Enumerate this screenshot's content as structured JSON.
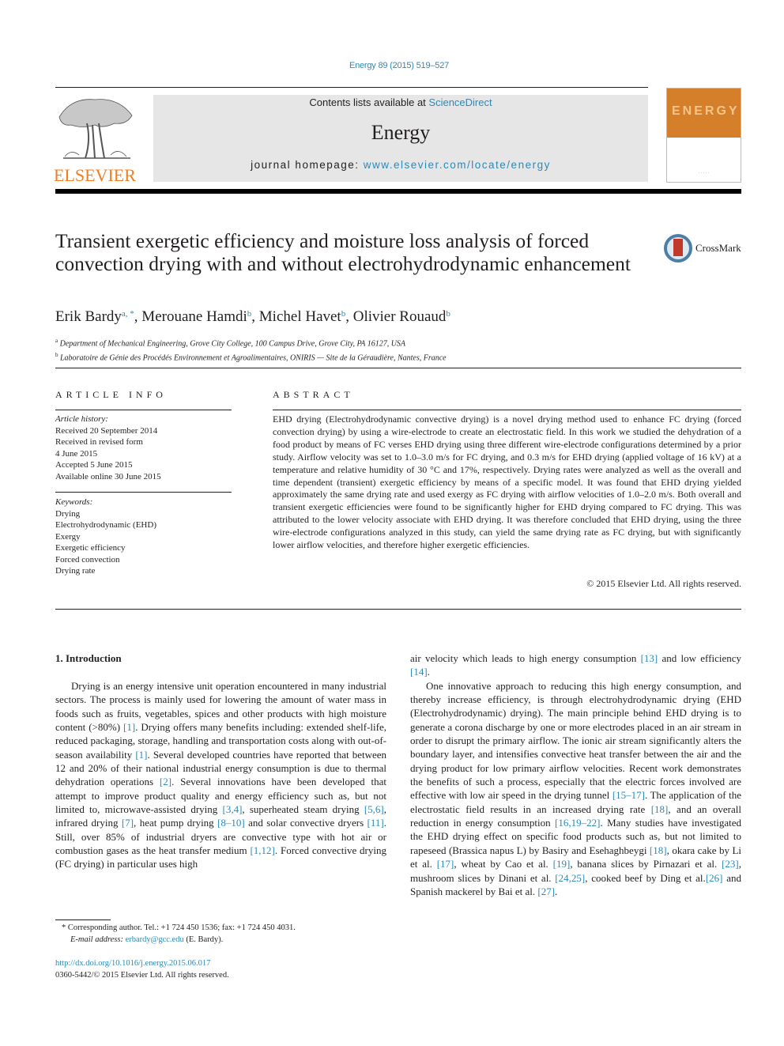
{
  "header": {
    "journal_ref": "Energy 89 (2015) 519–527",
    "publisher_logo_text": "ELSEVIER",
    "contents_prefix": "Contents lists available at ",
    "contents_link": "ScienceDirect",
    "journal_name": "Energy",
    "homepage_prefix": "journal homepage: ",
    "homepage_link": "www.elsevier.com/locate/energy",
    "cover_title": "ENERGY",
    "brand_color": "#f47c20",
    "link_color": "#2a8ab8"
  },
  "article": {
    "title": "Transient exergetic efficiency and moisture loss analysis of forced convection drying with and without electrohydrodynamic enhancement",
    "crossmark_label": "CrossMark",
    "authors": [
      {
        "name": "Erik Bardy",
        "sup": "a, *"
      },
      {
        "name": "Merouane Hamdi",
        "sup": "b"
      },
      {
        "name": "Michel Havet",
        "sup": "b"
      },
      {
        "name": "Olivier Rouaud",
        "sup": "b"
      }
    ],
    "affiliations": [
      {
        "sup": "a",
        "text": "Department of Mechanical Engineering, Grove City College, 100 Campus Drive, Grove City, PA 16127, USA"
      },
      {
        "sup": "b",
        "text": "Laboratoire de Génie des Procédés Environnement et Agroalimentaires, ONIRIS — Site de la Géraudière, Nantes, France"
      }
    ]
  },
  "article_info": {
    "heading": "ARTICLE INFO",
    "history_label": "Article history:",
    "history": [
      "Received 20 September 2014",
      "Received in revised form",
      "4 June 2015",
      "Accepted 5 June 2015",
      "Available online 30 June 2015"
    ],
    "keywords_label": "Keywords:",
    "keywords": [
      "Drying",
      "Electrohydrodynamic (EHD)",
      "Exergy",
      "Exergetic efficiency",
      "Forced convection",
      "Drying rate"
    ]
  },
  "abstract": {
    "heading": "ABSTRACT",
    "text": "EHD drying (Electrohydrodynamic convective drying) is a novel drying method used to enhance FC drying (forced convection drying) by using a wire-electrode to create an electrostatic field. In this work we studied the dehydration of a food product by means of FC verses EHD drying using three different wire-electrode configurations determined by a prior study. Airflow velocity was set to 1.0–3.0 m/s for FC drying, and 0.3 m/s for EHD drying (applied voltage of 16 kV) at a temperature and relative humidity of 30 °C and 17%, respectively. Drying rates were analyzed as well as the overall and time dependent (transient) exergetic efficiency by means of a specific model. It was found that EHD drying yielded approximately the same drying rate and used exergy as FC drying with airflow velocities of 1.0–2.0 m/s. Both overall and transient exergetic efficiencies were found to be significantly higher for EHD drying compared to FC drying. This was attributed to the lower velocity associate with EHD drying. It was therefore concluded that EHD drying, using the three wire-electrode configurations analyzed in this study, can yield the same drying rate as FC drying, but with significantly lower airflow velocities, and therefore higher exergetic efficiencies.",
    "copyright": "© 2015 Elsevier Ltd. All rights reserved."
  },
  "body": {
    "section_heading": "1.  Introduction",
    "col1": [
      {
        "t": "Drying is an energy intensive unit operation encountered in many industrial sectors. The process is mainly used for lowering the amount of water mass in foods such as fruits, vegetables, spices and other products with high moisture content (>80%) "
      },
      {
        "r": "[1]"
      },
      {
        "t": ". Drying offers many benefits including: extended shelf-life, reduced packaging, storage, handling and transportation costs along with out-of-season availability "
      },
      {
        "r": "[1]"
      },
      {
        "t": ". Several developed countries have reported that between 12 and 20% of their national industrial energy consumption is due to thermal dehydration operations "
      },
      {
        "r": "[2]"
      },
      {
        "t": ". Several innovations have been developed that attempt to improve product quality and energy efficiency such as, but not limited to, microwave-assisted drying "
      },
      {
        "r": "[3,4]"
      },
      {
        "t": ", superheated steam drying "
      },
      {
        "r": "[5,6]"
      },
      {
        "t": ", infrared drying "
      },
      {
        "r": "[7]"
      },
      {
        "t": ", heat pump drying "
      },
      {
        "r": "[8–10]"
      },
      {
        "t": " and solar convective dryers "
      },
      {
        "r": "[11]"
      },
      {
        "t": ". Still, over 85% of industrial dryers are convective type with hot air or combustion gases as the heat transfer medium "
      },
      {
        "r": "[1,12]"
      },
      {
        "t": ". Forced convective drying (FC drying) in particular uses high"
      }
    ],
    "col2_p1": [
      {
        "t": "air velocity which leads to high energy consumption "
      },
      {
        "r": "[13]"
      },
      {
        "t": " and low efficiency "
      },
      {
        "r": "[14]"
      },
      {
        "t": "."
      }
    ],
    "col2_p2": [
      {
        "t": "One innovative approach to reducing this high energy consumption, and thereby increase efficiency, is through electrohydrodynamic drying (EHD (Electrohydrodynamic) drying). The main principle behind EHD drying is to generate a corona discharge by one or more electrodes placed in an air stream in order to disrupt the primary airflow. The ionic air stream significantly alters the boundary layer, and intensifies convective heat transfer between the air and the drying product for low primary airflow velocities. Recent work demonstrates the benefits of such a process, especially that the electric forces involved are effective with low air speed in the drying tunnel "
      },
      {
        "r": "[15–17]"
      },
      {
        "t": ". The application of the electrostatic field results in an increased drying rate "
      },
      {
        "r": "[18]"
      },
      {
        "t": ", and an overall reduction in energy consumption "
      },
      {
        "r": "[16,19–22]"
      },
      {
        "t": ". Many studies have investigated the EHD drying effect on specific food products such as, but not limited to rapeseed (Brassica napus L) by Basiry and Esehaghbeygi "
      },
      {
        "r": "[18]"
      },
      {
        "t": ", okara cake by Li et al. "
      },
      {
        "r": "[17]"
      },
      {
        "t": ", wheat by Cao et al. "
      },
      {
        "r": "[19]"
      },
      {
        "t": ", banana slices by Pirnazari et al. "
      },
      {
        "r": "[23]"
      },
      {
        "t": ", mushroom slices by Dinani et al. "
      },
      {
        "r": "[24,25]"
      },
      {
        "t": ", cooked beef by Ding et al."
      },
      {
        "r": "[26]"
      },
      {
        "t": " and Spanish mackerel by Bai et al. "
      },
      {
        "r": "[27]"
      },
      {
        "t": "."
      }
    ]
  },
  "footnote": {
    "corresponding": "* Corresponding author. Tel.: +1 724 450 1536; fax: +1 724 450 4031.",
    "email_label": "E-mail address: ",
    "email": "erbardy@gcc.edu",
    "email_suffix": " (E. Bardy).",
    "doi": "http://dx.doi.org/10.1016/j.energy.2015.06.017",
    "issn": "0360-5442/© 2015 Elsevier Ltd. All rights reserved."
  }
}
